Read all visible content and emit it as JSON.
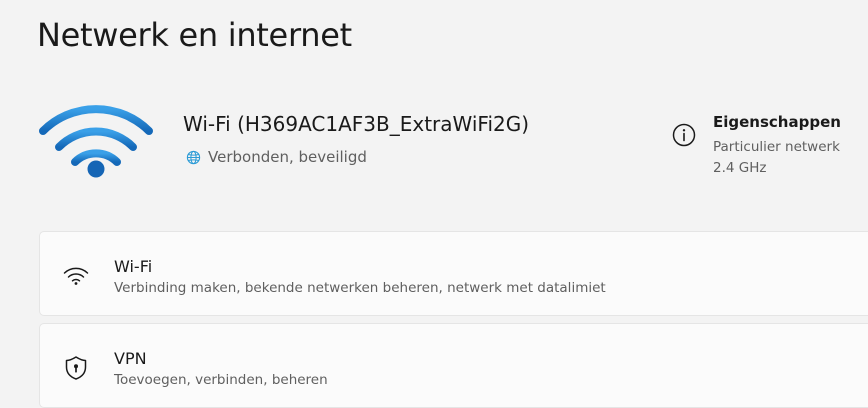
{
  "page": {
    "title": "Netwerk en internet"
  },
  "connection": {
    "network_name": "Wi-Fi (H369AC1AF3B_ExtraWiFi2G)",
    "status": "Verbonden, beveiligd",
    "icon": "wifi-signal-icon",
    "status_icon": "globe-icon",
    "accent_color": "#1f7fd1"
  },
  "properties": {
    "icon": "info-icon",
    "title": "Eigenschappen",
    "network_type": "Particulier netwerk",
    "band": "2.4 GHz"
  },
  "settings_cards": [
    {
      "icon": "wifi-icon",
      "title": "Wi-Fi",
      "description": "Verbinding maken, bekende netwerken beheren, netwerk met datalimiet"
    },
    {
      "icon": "shield-icon",
      "title": "VPN",
      "description": "Toevoegen, verbinden, beheren"
    }
  ]
}
